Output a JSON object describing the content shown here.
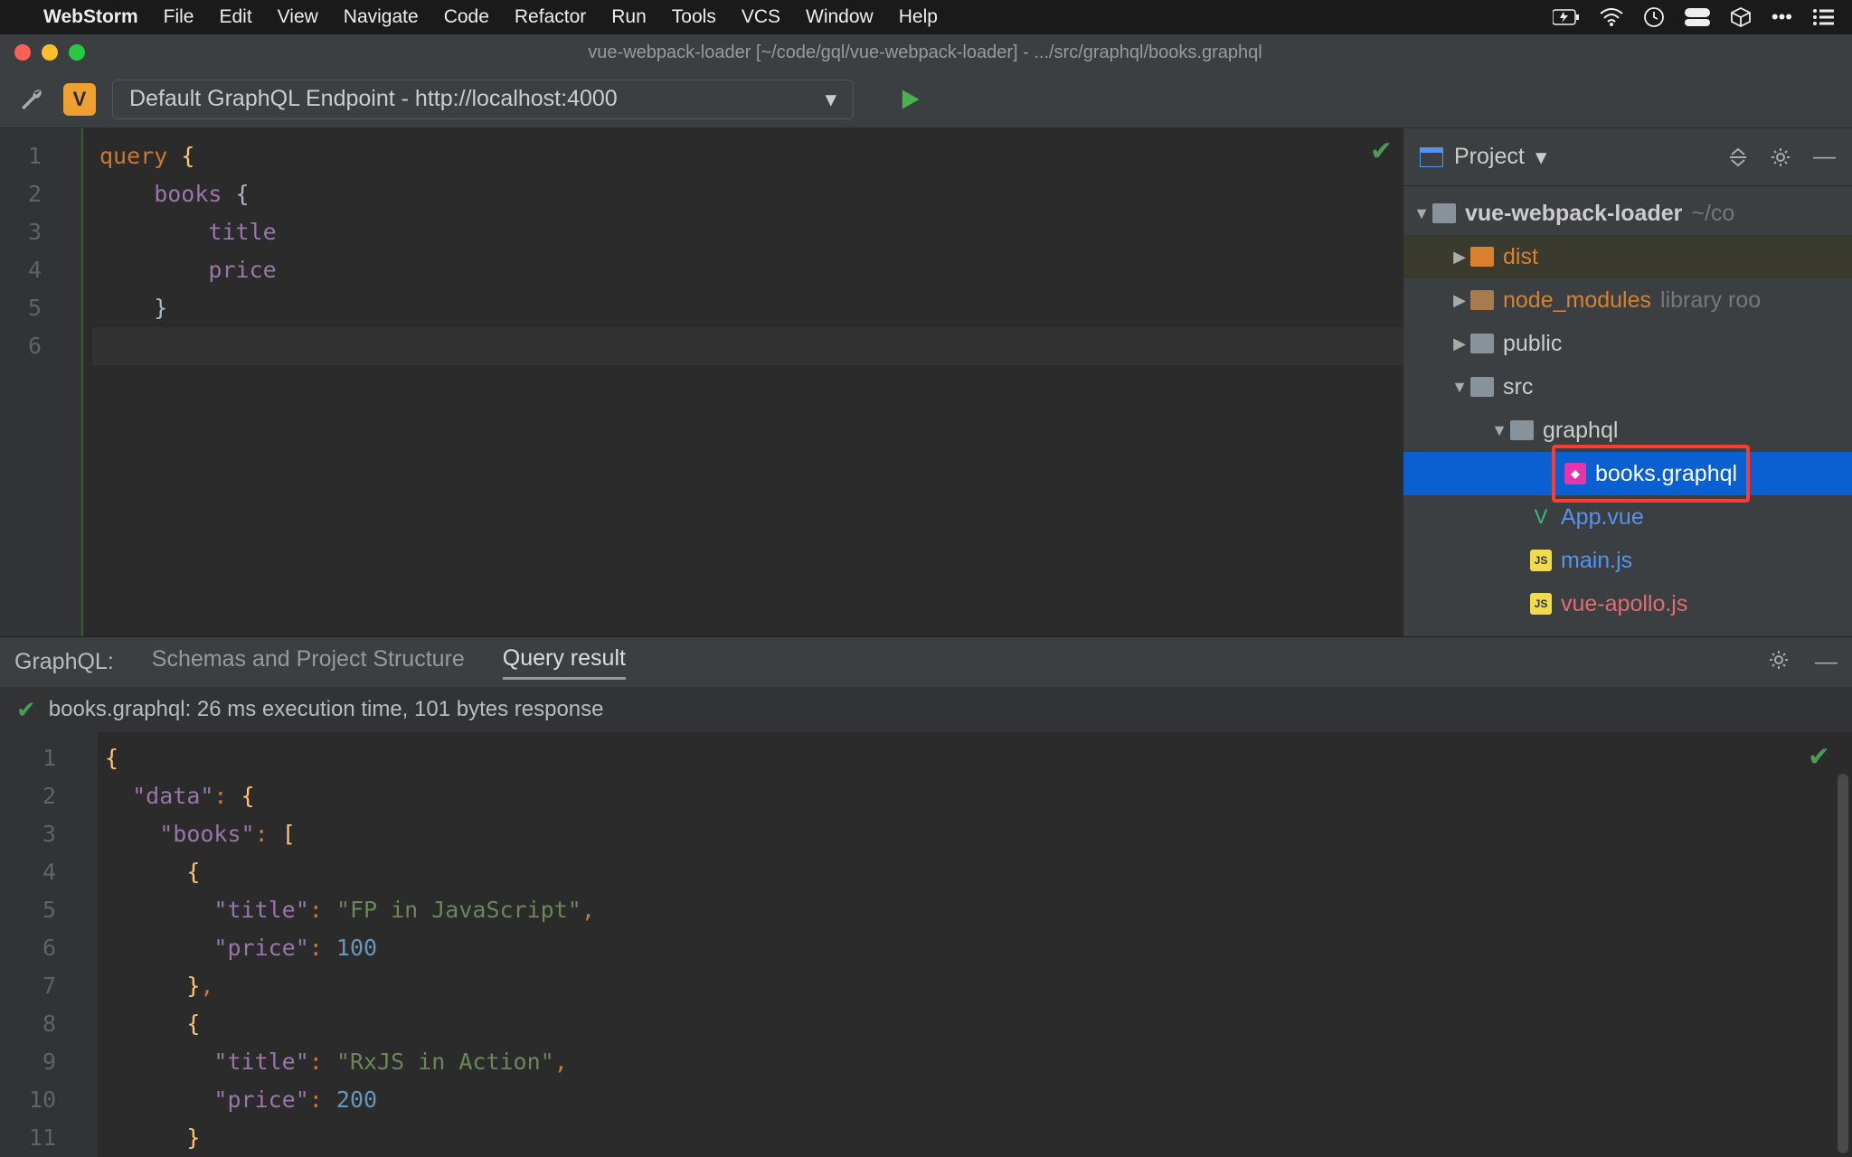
{
  "mac_menu": {
    "app": "WebStorm",
    "items": [
      "File",
      "Edit",
      "View",
      "Navigate",
      "Code",
      "Refactor",
      "Run",
      "Tools",
      "VCS",
      "Window",
      "Help"
    ]
  },
  "window_title": "vue-webpack-loader [~/code/gql/vue-webpack-loader] - .../src/graphql/books.graphql",
  "toolbar": {
    "endpoint_label": "Default GraphQL Endpoint - http://localhost:4000"
  },
  "editor": {
    "line_numbers": [
      "1",
      "2",
      "3",
      "4",
      "5",
      "6"
    ],
    "lines": [
      [
        {
          "t": "query ",
          "c": "kw"
        },
        {
          "t": "{",
          "c": "brace"
        }
      ],
      [
        {
          "t": "    books ",
          "c": "field"
        },
        {
          "t": "{",
          "c": "brace2"
        }
      ],
      [
        {
          "t": "        title",
          "c": "field"
        }
      ],
      [
        {
          "t": "        price",
          "c": "field"
        }
      ],
      [
        {
          "t": "    }",
          "c": "brace2"
        }
      ],
      [
        {
          "t": "}",
          "c": "brace"
        }
      ]
    ]
  },
  "sidebar": {
    "title": "Project",
    "tree": {
      "root": "vue-webpack-loader",
      "root_hint": "~/co",
      "dist": "dist",
      "node_modules": "node_modules",
      "node_modules_hint": "library roo",
      "public": "public",
      "src": "src",
      "graphql": "graphql",
      "books": "books.graphql",
      "app_vue": "App.vue",
      "main_js": "main.js",
      "vue_apollo": "vue-apollo.js"
    }
  },
  "bottom": {
    "label": "GraphQL:",
    "tab1": "Schemas and Project Structure",
    "tab2": "Query result",
    "status": "books.graphql: 26 ms execution time, 101 bytes response",
    "line_numbers": [
      "1",
      "2",
      "3",
      "4",
      "5",
      "6",
      "7",
      "8",
      "9",
      "10",
      "11"
    ],
    "result_lines": [
      [
        {
          "t": "{",
          "c": "jbr"
        }
      ],
      [
        {
          "t": "  ",
          "c": ""
        },
        {
          "t": "\"data\"",
          "c": "jkey"
        },
        {
          "t": ": ",
          "c": "jop"
        },
        {
          "t": "{",
          "c": "jbr"
        }
      ],
      [
        {
          "t": "    ",
          "c": ""
        },
        {
          "t": "\"books\"",
          "c": "jkey"
        },
        {
          "t": ": ",
          "c": "jop"
        },
        {
          "t": "[",
          "c": "jbr"
        }
      ],
      [
        {
          "t": "      ",
          "c": ""
        },
        {
          "t": "{",
          "c": "jbr"
        }
      ],
      [
        {
          "t": "        ",
          "c": ""
        },
        {
          "t": "\"title\"",
          "c": "jkey"
        },
        {
          "t": ": ",
          "c": "jop"
        },
        {
          "t": "\"FP in JavaScript\"",
          "c": "jstr"
        },
        {
          "t": ",",
          "c": "jop"
        }
      ],
      [
        {
          "t": "        ",
          "c": ""
        },
        {
          "t": "\"price\"",
          "c": "jkey"
        },
        {
          "t": ": ",
          "c": "jop"
        },
        {
          "t": "100",
          "c": "jnum"
        }
      ],
      [
        {
          "t": "      ",
          "c": ""
        },
        {
          "t": "}",
          "c": "jbr"
        },
        {
          "t": ",",
          "c": "jop"
        }
      ],
      [
        {
          "t": "      ",
          "c": ""
        },
        {
          "t": "{",
          "c": "jbr"
        }
      ],
      [
        {
          "t": "        ",
          "c": ""
        },
        {
          "t": "\"title\"",
          "c": "jkey"
        },
        {
          "t": ": ",
          "c": "jop"
        },
        {
          "t": "\"RxJS in Action\"",
          "c": "jstr"
        },
        {
          "t": ",",
          "c": "jop"
        }
      ],
      [
        {
          "t": "        ",
          "c": ""
        },
        {
          "t": "\"price\"",
          "c": "jkey"
        },
        {
          "t": ": ",
          "c": "jop"
        },
        {
          "t": "200",
          "c": "jnum"
        }
      ],
      [
        {
          "t": "      ",
          "c": ""
        },
        {
          "t": "}",
          "c": "jbr"
        }
      ]
    ]
  }
}
